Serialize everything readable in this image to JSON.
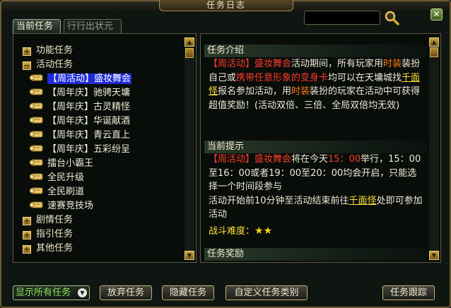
{
  "window": {
    "title": "任务日志",
    "close_icon": "✕"
  },
  "tabs": [
    {
      "label": "当前任务",
      "active": true
    },
    {
      "label": "行行出状元",
      "active": false
    }
  ],
  "search": {
    "value": ""
  },
  "tree": {
    "categories_top": [
      {
        "label": "功能任务",
        "toggle": "+"
      },
      {
        "label": "活动任务",
        "toggle": "−"
      }
    ],
    "quests": [
      {
        "label": "【周活动】盛妆舞会",
        "selected": true
      },
      {
        "label": "【周年庆】驰骋天墉"
      },
      {
        "label": "【周年庆】古灵精怪"
      },
      {
        "label": "【周年庆】华诞献酒"
      },
      {
        "label": "【周年庆】青云直上"
      },
      {
        "label": "【周年庆】五彩纷呈"
      },
      {
        "label": "擂台小霸王"
      },
      {
        "label": "全民升级"
      },
      {
        "label": "全民刷道"
      },
      {
        "label": "速赛竞技场"
      }
    ],
    "categories_bottom": [
      {
        "label": "剧情任务",
        "toggle": "+"
      },
      {
        "label": "指引任务",
        "toggle": "+"
      },
      {
        "label": "其他任务",
        "toggle": "+"
      }
    ]
  },
  "detail": {
    "intro_header": "任务介绍",
    "intro": {
      "p1": "【周活动】",
      "p2": "盛妆舞会",
      "p3": "活动期间，所有玩家用",
      "p4": "时装",
      "p5": "装扮自己或",
      "p6": "携带任意形象的变身卡",
      "p7": "均可以在天墉城找",
      "p8": "千面怪",
      "p9": "报名参加活动，用",
      "p10": "时装",
      "p11": "装扮的玩家在活动中可获得超值奖励！(活动双倍、三倍、全局双倍均无效)"
    },
    "hint_header": "当前提示",
    "hint": {
      "p1": "【周活动】",
      "p2": "盛妆舞会",
      "p3": "将在今天",
      "p4": "15：00",
      "p5": "举行，15：00至16：00或者19：00至20：00均会开启，只能选择一个时间段参与",
      "p6": "活动开始前10分钟至活动结束前往",
      "p7": "千面怪",
      "p8": "处即可参加活动"
    },
    "difficulty_label": "战斗难度：",
    "difficulty_stars": 2,
    "reward_header": "任务奖励"
  },
  "bottom": {
    "filter_value": "显示所有任务",
    "abandon": "放弃任务",
    "hide": "隐藏任务",
    "custom": "自定义任务类别",
    "track": "任务跟踪"
  },
  "icons": {
    "close": "close-icon",
    "search": "magnifier-icon",
    "quest": "scroll-icon",
    "scroll_up": "arrow-up-icon",
    "scroll_down": "arrow-down-icon",
    "dropdown": "chevron-down-icon",
    "star": "star-icon"
  }
}
